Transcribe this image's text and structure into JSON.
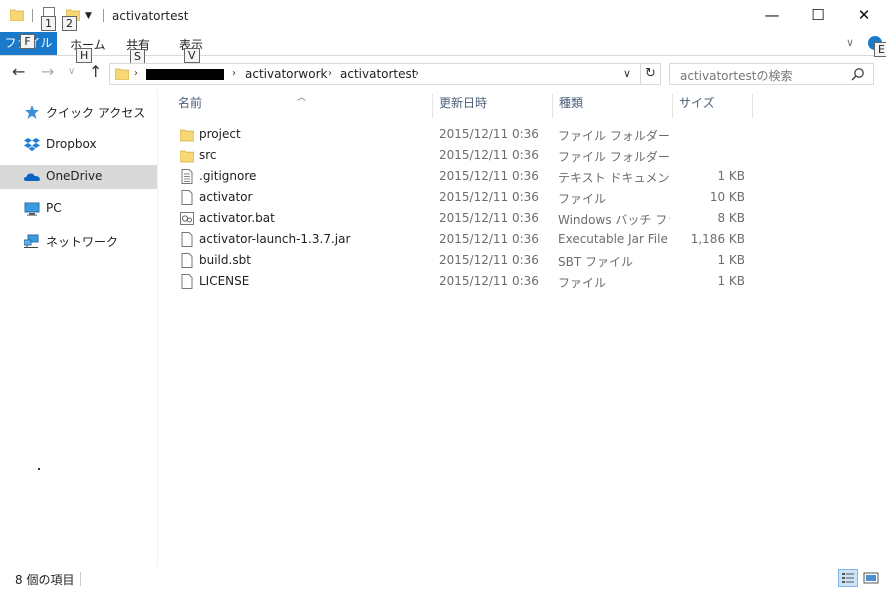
{
  "window": {
    "title": "activatortest",
    "keytips": {
      "qat1": "1",
      "qat2": "2",
      "file": "F",
      "home": "H",
      "share": "S",
      "view": "V",
      "help": "E"
    },
    "controls": {
      "minimize": "—",
      "maximize": "☐",
      "close": "✕"
    }
  },
  "ribbon": {
    "file_tab": "ファイル",
    "tabs": [
      "ホーム",
      "共有",
      "表示"
    ],
    "help_badge": "?"
  },
  "address_bar": {
    "crumbs": [
      "activatorwork",
      "activatortest"
    ],
    "search_placeholder": "activatortestの検索"
  },
  "nav_pane": {
    "items": [
      {
        "label": "クイック アクセス",
        "icon": "star-icon"
      },
      {
        "label": "Dropbox",
        "icon": "dropbox-icon"
      },
      {
        "label": "OneDrive",
        "icon": "onedrive-icon",
        "selected": true
      },
      {
        "label": "PC",
        "icon": "pc-icon"
      },
      {
        "label": "ネットワーク",
        "icon": "network-icon"
      }
    ]
  },
  "columns": {
    "name": "名前",
    "date": "更新日時",
    "type": "種類",
    "size": "サイズ"
  },
  "files": [
    {
      "name": "project",
      "date": "2015/12/11 0:36",
      "type": "ファイル フォルダー",
      "size": "",
      "icon": "folder-icon"
    },
    {
      "name": "src",
      "date": "2015/12/11 0:36",
      "type": "ファイル フォルダー",
      "size": "",
      "icon": "folder-icon"
    },
    {
      "name": ".gitignore",
      "date": "2015/12/11 0:36",
      "type": "テキスト ドキュメント",
      "size": "1 KB",
      "icon": "text-file-icon"
    },
    {
      "name": "activator",
      "date": "2015/12/11 0:36",
      "type": "ファイル",
      "size": "10 KB",
      "icon": "file-icon"
    },
    {
      "name": "activator.bat",
      "date": "2015/12/11 0:36",
      "type": "Windows バッチ ファ...",
      "size": "8 KB",
      "icon": "batch-file-icon"
    },
    {
      "name": "activator-launch-1.3.7.jar",
      "date": "2015/12/11 0:36",
      "type": "Executable Jar File",
      "size": "1,186 KB",
      "icon": "file-icon"
    },
    {
      "name": "build.sbt",
      "date": "2015/12/11 0:36",
      "type": "SBT ファイル",
      "size": "1 KB",
      "icon": "file-icon"
    },
    {
      "name": "LICENSE",
      "date": "2015/12/11 0:36",
      "type": "ファイル",
      "size": "1 KB",
      "icon": "file-icon"
    }
  ],
  "status": {
    "item_count": "8 個の項目"
  },
  "colors": {
    "accent": "#1979ca",
    "folder": "#f8d775",
    "selection": "#d9d9d9"
  }
}
